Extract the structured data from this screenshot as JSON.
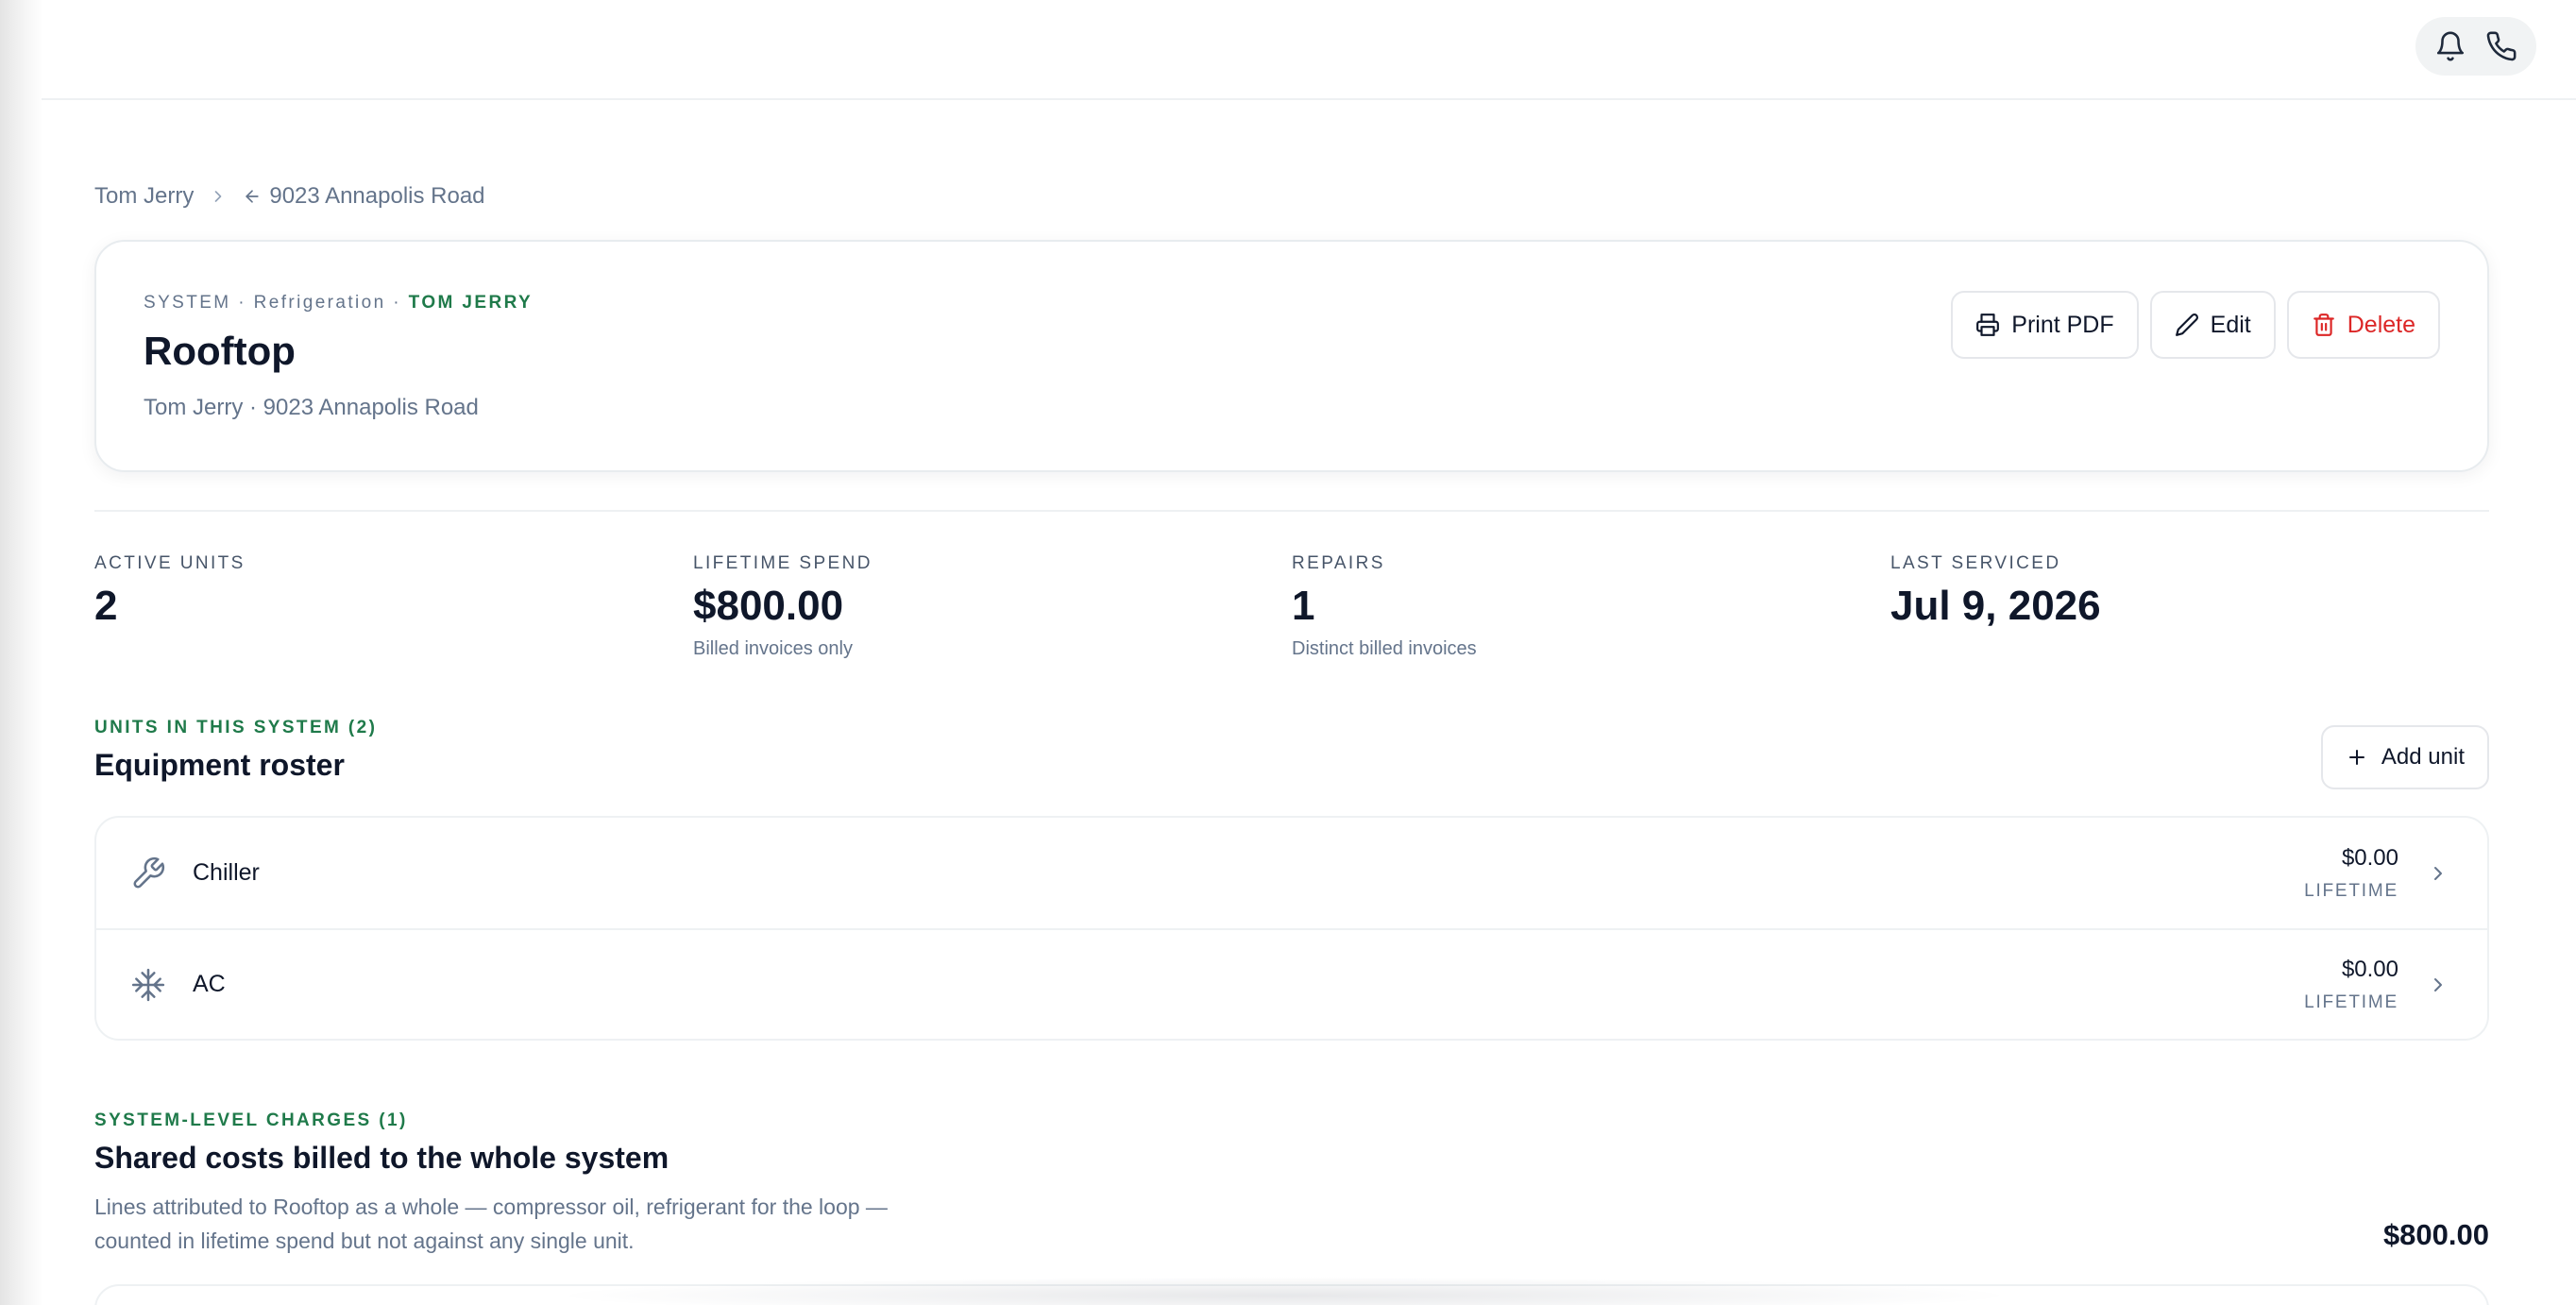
{
  "topbar": {
    "icons": [
      "bell-icon",
      "phone-icon"
    ]
  },
  "breadcrumb": {
    "customer": "Tom Jerry",
    "location": "9023 Annapolis Road"
  },
  "header": {
    "eyebrow_prefix": "SYSTEM · Refrigeration · ",
    "eyebrow_owner": "TOM JERRY",
    "title": "Rooftop",
    "subtitle": "Tom Jerry · 9023 Annapolis Road",
    "buttons": {
      "print": "Print PDF",
      "edit": "Edit",
      "delete": "Delete"
    }
  },
  "stats": [
    {
      "label": "ACTIVE UNITS",
      "value": "2",
      "note": ""
    },
    {
      "label": "LIFETIME SPEND",
      "value": "$800.00",
      "note": "Billed invoices only"
    },
    {
      "label": "REPAIRS",
      "value": "1",
      "note": "Distinct billed invoices"
    },
    {
      "label": "LAST SERVICED",
      "value": "Jul 9, 2026",
      "note": ""
    }
  ],
  "units_section": {
    "eyebrow": "UNITS IN THIS SYSTEM (2)",
    "title": "Equipment roster",
    "add_button": "Add unit",
    "units": [
      {
        "name": "Chiller",
        "icon": "wrench-icon",
        "amount": "$0.00",
        "amount_label": "LIFETIME"
      },
      {
        "name": "AC",
        "icon": "snowflake-icon",
        "amount": "$0.00",
        "amount_label": "LIFETIME"
      }
    ]
  },
  "charges_section": {
    "eyebrow": "SYSTEM-LEVEL CHARGES (1)",
    "title": "Shared costs billed to the whole system",
    "description": "Lines attributed to Rooftop as a whole — compressor oil, refrigerant for the loop — counted in lifetime spend but not against any single unit.",
    "total": "$800.00"
  },
  "colors": {
    "accent_green": "#1f7a4a",
    "danger_red": "#dc2626",
    "text_primary": "#0f172a",
    "text_muted": "#64748b"
  }
}
